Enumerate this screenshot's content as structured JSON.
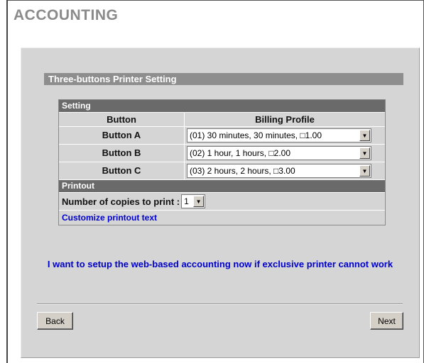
{
  "page": {
    "title": "ACCOUNTING"
  },
  "section": {
    "title": "Three-buttons Printer Setting"
  },
  "settings": {
    "header": "Setting",
    "columns": {
      "button": "Button",
      "profile": "Billing Profile"
    },
    "rows": [
      {
        "button": "Button A",
        "profile": "(01) 30 minutes, 30 minutes, □1.00"
      },
      {
        "button": "Button B",
        "profile": "(02) 1 hour, 1 hours, □2.00"
      },
      {
        "button": "Button C",
        "profile": "(03) 2 hours, 2 hours, □3.00"
      }
    ]
  },
  "printout": {
    "header": "Printout",
    "copies_label": "Number of copies to print :",
    "copies_value": "1",
    "customize_link": "Customize printout text"
  },
  "notice": "I want to setup the web-based accounting now if exclusive printer cannot work",
  "buttons": {
    "back": "Back",
    "next": "Next"
  },
  "icons": {
    "dropdown": "chevron-down-icon"
  }
}
